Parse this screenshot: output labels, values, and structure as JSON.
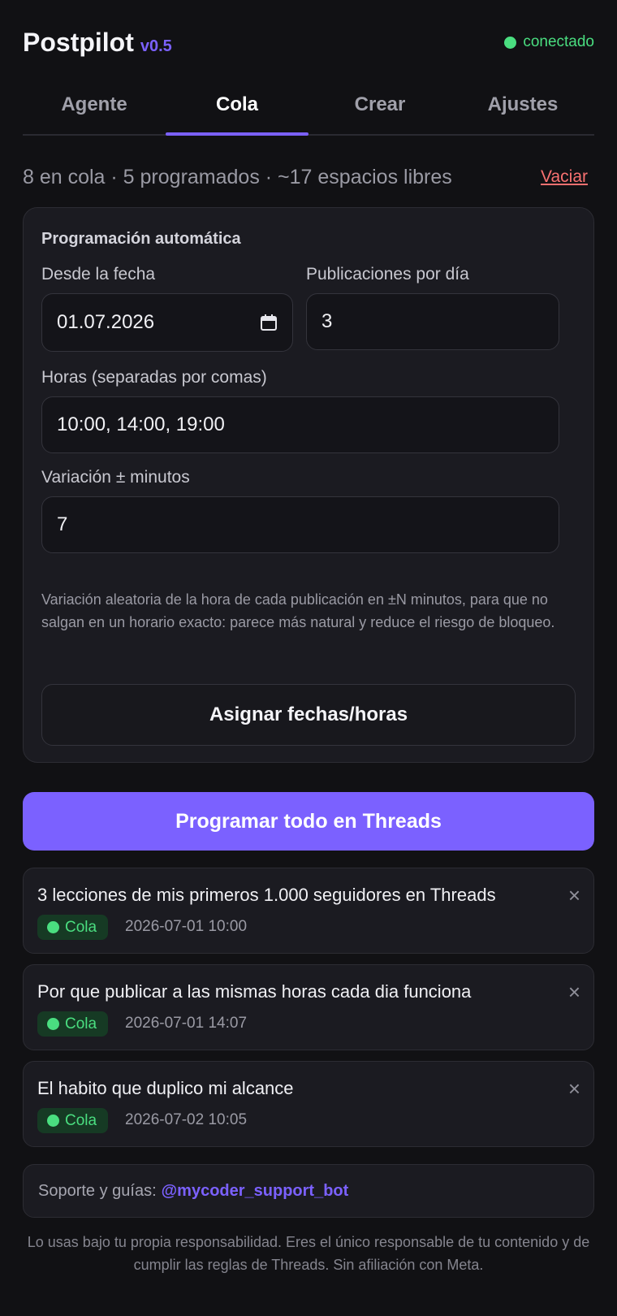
{
  "header": {
    "app_name": "Postpilot",
    "version": "v0.5",
    "status": "conectado",
    "status_color": "#4ade80"
  },
  "tabs": [
    {
      "label": "Agente",
      "active": false
    },
    {
      "label": "Cola",
      "active": true
    },
    {
      "label": "Crear",
      "active": false
    },
    {
      "label": "Ajustes",
      "active": false
    }
  ],
  "summary": {
    "text": "8 en cola · 5 programados · ~17 espacios libres",
    "clear_label": "Vaciar"
  },
  "auto_schedule": {
    "title": "Programación automática",
    "date_label": "Desde la fecha",
    "date_value": "01.07.2026",
    "per_day_label": "Publicaciones por día",
    "per_day_value": "3",
    "hours_label": "Horas (separadas por comas)",
    "hours_value": "10:00, 14:00, 19:00",
    "variation_label": "Variación ± minutos",
    "variation_value": "7",
    "hint": "Variación aleatoria de la hora de cada publicación en ±N minutos, para que no salgan en un horario exacto: parece más natural y reduce el riesgo de bloqueo.",
    "assign_button": "Asignar fechas/horas"
  },
  "primary_button": "Programar todo en Threads",
  "posts": [
    {
      "title": "3 lecciones de mis primeros 1.000 seguidores en Threads",
      "status": "Cola",
      "datetime": "2026-07-01 10:00"
    },
    {
      "title": "Por que publicar a las mismas horas cada dia funciona",
      "status": "Cola",
      "datetime": "2026-07-01 14:07"
    },
    {
      "title": "El habito que duplico mi alcance",
      "status": "Cola",
      "datetime": "2026-07-02 10:05"
    }
  ],
  "close_glyph": "×",
  "support": {
    "label": "Soporte y guías:",
    "link": "@mycoder_support_bot"
  },
  "disclaimer": "Lo usas bajo tu propia responsabilidad. Eres el único responsable de tu contenido y de cumplir las reglas de Threads. Sin afiliación con Meta.",
  "colors": {
    "accent": "#7b61ff",
    "background": "#111114",
    "danger": "#f87171",
    "success": "#4ade80"
  }
}
